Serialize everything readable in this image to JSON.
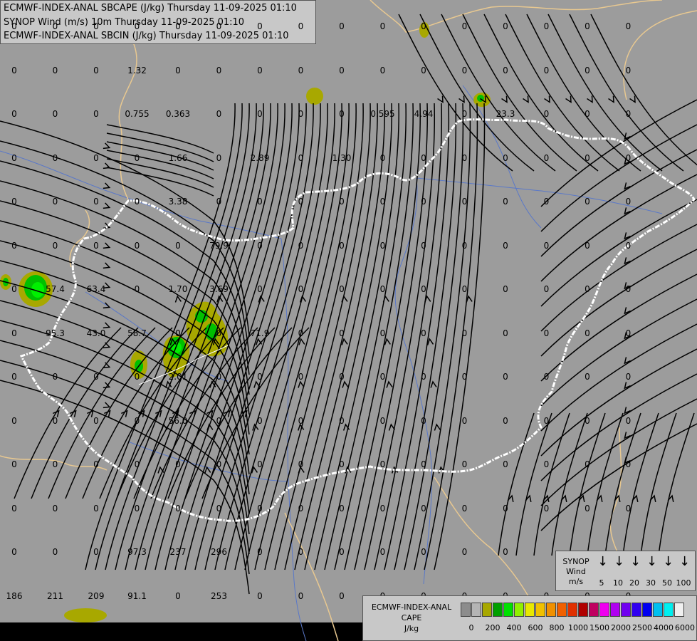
{
  "title": {
    "lines": [
      "ECMWF-INDEX-ANAL SBCAPE (J/kg) Thursday 11-09-2025 01:10",
      "SYNOP Wind (m/s) 10m Thursday 11-09-2025 01:10",
      "ECMWF-INDEX-ANAL SBCIN (J/kg) Thursday 11-09-2025 01:10"
    ]
  },
  "grid_values": [
    {
      "t": "0",
      "c": 0,
      "r": 0
    },
    {
      "t": "0",
      "c": 1,
      "r": 0
    },
    {
      "t": "0",
      "c": 2,
      "r": 0
    },
    {
      "t": "0",
      "c": 3,
      "r": 0
    },
    {
      "t": "0",
      "c": 4,
      "r": 0
    },
    {
      "t": "0",
      "c": 5,
      "r": 0
    },
    {
      "t": "0",
      "c": 6,
      "r": 0
    },
    {
      "t": "0",
      "c": 7,
      "r": 0
    },
    {
      "t": "0",
      "c": 8,
      "r": 0
    },
    {
      "t": "0",
      "c": 9,
      "r": 0
    },
    {
      "t": "0",
      "c": 10,
      "r": 0
    },
    {
      "t": "0",
      "c": 11,
      "r": 0
    },
    {
      "t": "0",
      "c": 12,
      "r": 0
    },
    {
      "t": "0",
      "c": 13,
      "r": 0
    },
    {
      "t": "0",
      "c": 14,
      "r": 0
    },
    {
      "t": "0",
      "c": 15,
      "r": 0
    },
    {
      "t": "0",
      "c": 0,
      "r": 1
    },
    {
      "t": "0",
      "c": 1,
      "r": 1
    },
    {
      "t": "0",
      "c": 2,
      "r": 1
    },
    {
      "t": "1.32",
      "c": 3,
      "r": 1
    },
    {
      "t": "0",
      "c": 4,
      "r": 1
    },
    {
      "t": "0",
      "c": 5,
      "r": 1
    },
    {
      "t": "0",
      "c": 6,
      "r": 1
    },
    {
      "t": "0",
      "c": 7,
      "r": 1
    },
    {
      "t": "0",
      "c": 8,
      "r": 1
    },
    {
      "t": "0",
      "c": 9,
      "r": 1
    },
    {
      "t": "0",
      "c": 10,
      "r": 1
    },
    {
      "t": "0",
      "c": 11,
      "r": 1
    },
    {
      "t": "0",
      "c": 12,
      "r": 1
    },
    {
      "t": "0",
      "c": 13,
      "r": 1
    },
    {
      "t": "0",
      "c": 14,
      "r": 1
    },
    {
      "t": "0",
      "c": 15,
      "r": 1
    },
    {
      "t": "0",
      "c": 0,
      "r": 2
    },
    {
      "t": "0",
      "c": 1,
      "r": 2
    },
    {
      "t": "0",
      "c": 2,
      "r": 2
    },
    {
      "t": "0.755",
      "c": 3,
      "r": 2
    },
    {
      "t": "0.363",
      "c": 4,
      "r": 2
    },
    {
      "t": "0",
      "c": 5,
      "r": 2
    },
    {
      "t": "0",
      "c": 6,
      "r": 2
    },
    {
      "t": "0",
      "c": 7,
      "r": 2
    },
    {
      "t": "0",
      "c": 8,
      "r": 2
    },
    {
      "t": "0.595",
      "c": 9,
      "r": 2
    },
    {
      "t": "4.94",
      "c": 10,
      "r": 2
    },
    {
      "t": "0",
      "c": 11,
      "r": 2
    },
    {
      "t": "23.3",
      "c": 12,
      "r": 2
    },
    {
      "t": "0",
      "c": 13,
      "r": 2
    },
    {
      "t": "0",
      "c": 14,
      "r": 2
    },
    {
      "t": "0",
      "c": 15,
      "r": 2
    },
    {
      "t": "0",
      "c": 0,
      "r": 3
    },
    {
      "t": "0",
      "c": 1,
      "r": 3
    },
    {
      "t": "0",
      "c": 2,
      "r": 3
    },
    {
      "t": "0",
      "c": 3,
      "r": 3
    },
    {
      "t": "1.66",
      "c": 4,
      "r": 3
    },
    {
      "t": "0",
      "c": 5,
      "r": 3
    },
    {
      "t": "2.89",
      "c": 6,
      "r": 3
    },
    {
      "t": "0",
      "c": 7,
      "r": 3
    },
    {
      "t": "1.30",
      "c": 8,
      "r": 3
    },
    {
      "t": "0",
      "c": 9,
      "r": 3
    },
    {
      "t": "0",
      "c": 10,
      "r": 3
    },
    {
      "t": "0",
      "c": 11,
      "r": 3
    },
    {
      "t": "0",
      "c": 12,
      "r": 3
    },
    {
      "t": "0",
      "c": 13,
      "r": 3
    },
    {
      "t": "0",
      "c": 14,
      "r": 3
    },
    {
      "t": "0",
      "c": 15,
      "r": 3
    },
    {
      "t": "0",
      "c": 0,
      "r": 4
    },
    {
      "t": "0",
      "c": 1,
      "r": 4
    },
    {
      "t": "0",
      "c": 2,
      "r": 4
    },
    {
      "t": "0",
      "c": 3,
      "r": 4
    },
    {
      "t": "3.38",
      "c": 4,
      "r": 4
    },
    {
      "t": "0",
      "c": 5,
      "r": 4
    },
    {
      "t": "0",
      "c": 6,
      "r": 4
    },
    {
      "t": "0",
      "c": 7,
      "r": 4
    },
    {
      "t": "0",
      "c": 8,
      "r": 4
    },
    {
      "t": "0",
      "c": 9,
      "r": 4
    },
    {
      "t": "0",
      "c": 10,
      "r": 4
    },
    {
      "t": "0",
      "c": 11,
      "r": 4
    },
    {
      "t": "0",
      "c": 12,
      "r": 4
    },
    {
      "t": "0",
      "c": 13,
      "r": 4
    },
    {
      "t": "0",
      "c": 14,
      "r": 4
    },
    {
      "t": "0",
      "c": 15,
      "r": 4
    },
    {
      "t": "0",
      "c": 0,
      "r": 5
    },
    {
      "t": "0",
      "c": 1,
      "r": 5
    },
    {
      "t": "0",
      "c": 2,
      "r": 5
    },
    {
      "t": "0",
      "c": 3,
      "r": 5
    },
    {
      "t": "0",
      "c": 4,
      "r": 5
    },
    {
      "t": "79.9",
      "c": 5,
      "r": 5
    },
    {
      "t": "0",
      "c": 6,
      "r": 5
    },
    {
      "t": "0",
      "c": 7,
      "r": 5
    },
    {
      "t": "0",
      "c": 8,
      "r": 5
    },
    {
      "t": "0",
      "c": 9,
      "r": 5
    },
    {
      "t": "0",
      "c": 10,
      "r": 5
    },
    {
      "t": "0",
      "c": 11,
      "r": 5
    },
    {
      "t": "0",
      "c": 12,
      "r": 5
    },
    {
      "t": "0",
      "c": 13,
      "r": 5
    },
    {
      "t": "0",
      "c": 14,
      "r": 5
    },
    {
      "t": "0",
      "c": 15,
      "r": 5
    },
    {
      "t": "0",
      "c": 0,
      "r": 6
    },
    {
      "t": "57.4",
      "c": 1,
      "r": 6
    },
    {
      "t": "63.4",
      "c": 2,
      "r": 6
    },
    {
      "t": "0",
      "c": 3,
      "r": 6
    },
    {
      "t": "1.70",
      "c": 4,
      "r": 6
    },
    {
      "t": "3.69",
      "c": 5,
      "r": 6
    },
    {
      "t": "0",
      "c": 6,
      "r": 6
    },
    {
      "t": "0",
      "c": 7,
      "r": 6
    },
    {
      "t": "0",
      "c": 8,
      "r": 6
    },
    {
      "t": "0",
      "c": 9,
      "r": 6
    },
    {
      "t": "0",
      "c": 10,
      "r": 6
    },
    {
      "t": "0",
      "c": 11,
      "r": 6
    },
    {
      "t": "0",
      "c": 12,
      "r": 6
    },
    {
      "t": "0",
      "c": 13,
      "r": 6
    },
    {
      "t": "0",
      "c": 14,
      "r": 6
    },
    {
      "t": "0",
      "c": 15,
      "r": 6
    },
    {
      "t": "0",
      "c": 0,
      "r": 7
    },
    {
      "t": "95.3",
      "c": 1,
      "r": 7
    },
    {
      "t": "43.0",
      "c": 2,
      "r": 7
    },
    {
      "t": "58.7",
      "c": 3,
      "r": 7
    },
    {
      "t": "0",
      "c": 4,
      "r": 7
    },
    {
      "t": "0",
      "c": 5,
      "r": 7
    },
    {
      "t": "71.9",
      "c": 6,
      "r": 7
    },
    {
      "t": "0",
      "c": 7,
      "r": 7
    },
    {
      "t": "0",
      "c": 8,
      "r": 7
    },
    {
      "t": "0",
      "c": 9,
      "r": 7
    },
    {
      "t": "0",
      "c": 10,
      "r": 7
    },
    {
      "t": "0",
      "c": 11,
      "r": 7
    },
    {
      "t": "0",
      "c": 12,
      "r": 7
    },
    {
      "t": "0",
      "c": 13,
      "r": 7
    },
    {
      "t": "0",
      "c": 14,
      "r": 7
    },
    {
      "t": "0",
      "c": 15,
      "r": 7
    },
    {
      "t": "0",
      "c": 0,
      "r": 8
    },
    {
      "t": "0",
      "c": 1,
      "r": 8
    },
    {
      "t": "0",
      "c": 2,
      "r": 8
    },
    {
      "t": "0",
      "c": 3,
      "r": 8
    },
    {
      "t": "2.01",
      "c": 4,
      "r": 8
    },
    {
      "t": "0",
      "c": 5,
      "r": 8
    },
    {
      "t": "0",
      "c": 6,
      "r": 8
    },
    {
      "t": "0",
      "c": 7,
      "r": 8
    },
    {
      "t": "0",
      "c": 8,
      "r": 8
    },
    {
      "t": "0",
      "c": 9,
      "r": 8
    },
    {
      "t": "0",
      "c": 10,
      "r": 8
    },
    {
      "t": "0",
      "c": 11,
      "r": 8
    },
    {
      "t": "0",
      "c": 12,
      "r": 8
    },
    {
      "t": "0",
      "c": 13,
      "r": 8
    },
    {
      "t": "0",
      "c": 14,
      "r": 8
    },
    {
      "t": "0",
      "c": 15,
      "r": 8
    },
    {
      "t": "0",
      "c": 0,
      "r": 9
    },
    {
      "t": "0",
      "c": 1,
      "r": 9
    },
    {
      "t": "0",
      "c": 2,
      "r": 9
    },
    {
      "t": "0",
      "c": 3,
      "r": 9
    },
    {
      "t": "56.0",
      "c": 4,
      "r": 9
    },
    {
      "t": "0",
      "c": 5,
      "r": 9
    },
    {
      "t": "0",
      "c": 6,
      "r": 9
    },
    {
      "t": "0",
      "c": 7,
      "r": 9
    },
    {
      "t": "0",
      "c": 8,
      "r": 9
    },
    {
      "t": "0",
      "c": 9,
      "r": 9
    },
    {
      "t": "0",
      "c": 10,
      "r": 9
    },
    {
      "t": "0",
      "c": 11,
      "r": 9
    },
    {
      "t": "0",
      "c": 12,
      "r": 9
    },
    {
      "t": "0",
      "c": 13,
      "r": 9
    },
    {
      "t": "0",
      "c": 14,
      "r": 9
    },
    {
      "t": "0",
      "c": 15,
      "r": 9
    },
    {
      "t": "0",
      "c": 0,
      "r": 10
    },
    {
      "t": "0",
      "c": 1,
      "r": 10
    },
    {
      "t": "0",
      "c": 2,
      "r": 10
    },
    {
      "t": "0",
      "c": 3,
      "r": 10
    },
    {
      "t": "0",
      "c": 4,
      "r": 10
    },
    {
      "t": "0",
      "c": 5,
      "r": 10
    },
    {
      "t": "0",
      "c": 6,
      "r": 10
    },
    {
      "t": "0",
      "c": 7,
      "r": 10
    },
    {
      "t": "0",
      "c": 8,
      "r": 10
    },
    {
      "t": "0",
      "c": 9,
      "r": 10
    },
    {
      "t": "0",
      "c": 10,
      "r": 10
    },
    {
      "t": "0",
      "c": 11,
      "r": 10
    },
    {
      "t": "0",
      "c": 12,
      "r": 10
    },
    {
      "t": "0",
      "c": 13,
      "r": 10
    },
    {
      "t": "0",
      "c": 14,
      "r": 10
    },
    {
      "t": "0",
      "c": 15,
      "r": 10
    },
    {
      "t": "0",
      "c": 0,
      "r": 11
    },
    {
      "t": "0",
      "c": 1,
      "r": 11
    },
    {
      "t": "0",
      "c": 2,
      "r": 11
    },
    {
      "t": "0",
      "c": 3,
      "r": 11
    },
    {
      "t": "0",
      "c": 4,
      "r": 11
    },
    {
      "t": "0",
      "c": 5,
      "r": 11
    },
    {
      "t": "0",
      "c": 6,
      "r": 11
    },
    {
      "t": "0",
      "c": 7,
      "r": 11
    },
    {
      "t": "0",
      "c": 8,
      "r": 11
    },
    {
      "t": "0",
      "c": 9,
      "r": 11
    },
    {
      "t": "0",
      "c": 10,
      "r": 11
    },
    {
      "t": "0",
      "c": 11,
      "r": 11
    },
    {
      "t": "0",
      "c": 12,
      "r": 11
    },
    {
      "t": "0",
      "c": 13,
      "r": 11
    },
    {
      "t": "0",
      "c": 14,
      "r": 11
    },
    {
      "t": "0",
      "c": 15,
      "r": 11
    },
    {
      "t": "0",
      "c": 0,
      "r": 12
    },
    {
      "t": "0",
      "c": 1,
      "r": 12
    },
    {
      "t": "0",
      "c": 2,
      "r": 12
    },
    {
      "t": "97.3",
      "c": 3,
      "r": 12
    },
    {
      "t": "237",
      "c": 4,
      "r": 12
    },
    {
      "t": "296",
      "c": 5,
      "r": 12
    },
    {
      "t": "0",
      "c": 6,
      "r": 12
    },
    {
      "t": "0",
      "c": 7,
      "r": 12
    },
    {
      "t": "0",
      "c": 8,
      "r": 12
    },
    {
      "t": "0",
      "c": 9,
      "r": 12
    },
    {
      "t": "0",
      "c": 10,
      "r": 12
    },
    {
      "t": "0",
      "c": 11,
      "r": 12
    },
    {
      "t": "0",
      "c": 12,
      "r": 12
    },
    {
      "t": "186",
      "c": 0,
      "r": 13
    },
    {
      "t": "211",
      "c": 1,
      "r": 13
    },
    {
      "t": "209",
      "c": 2,
      "r": 13
    },
    {
      "t": "91.1",
      "c": 3,
      "r": 13
    },
    {
      "t": "0",
      "c": 4,
      "r": 13
    },
    {
      "t": "253",
      "c": 5,
      "r": 13
    },
    {
      "t": "0",
      "c": 6,
      "r": 13
    },
    {
      "t": "0",
      "c": 7,
      "r": 13
    },
    {
      "t": "0",
      "c": 8,
      "r": 13
    },
    {
      "t": "0",
      "c": 9,
      "r": 13
    },
    {
      "t": "0",
      "c": 10,
      "r": 13
    },
    {
      "t": "0",
      "c": 11,
      "r": 13
    },
    {
      "t": "0",
      "c": 12,
      "r": 13
    },
    {
      "t": "0",
      "c": 13,
      "r": 13
    },
    {
      "t": "0",
      "c": 14,
      "r": 13
    },
    {
      "t": "0",
      "c": 15,
      "r": 13
    }
  ],
  "synop_legend": {
    "title_lines": [
      "SYNOP",
      "Wind",
      "m/s"
    ],
    "values": [
      "5",
      "10",
      "20",
      "30",
      "50",
      "100"
    ]
  },
  "cape_legend": {
    "title_lines": [
      "ECMWF-INDEX-ANAL",
      "CAPE",
      "J/kg"
    ],
    "colors": [
      "#8c8c8c",
      "#b4b4b4",
      "#a8a800",
      "#00a000",
      "#00e000",
      "#90f000",
      "#e8e800",
      "#f0c000",
      "#f09000",
      "#f06000",
      "#e03000",
      "#b00000",
      "#c00060",
      "#f000f0",
      "#b000f0",
      "#7000f0",
      "#3000f0",
      "#0000f0",
      "#00c0f0",
      "#00f0f0",
      "#f0f0f0"
    ],
    "ticks": [
      "0",
      "200",
      "400",
      "600",
      "800",
      "1000",
      "1500",
      "2000",
      "2500",
      "4000",
      "6000"
    ]
  },
  "map_colors": {
    "background": "#9c9c9c",
    "hungary_border": "#ffffff",
    "other_borders": "#e8c890",
    "rivers": "#5a78c8",
    "streamlines": "#000000",
    "cape_low": "#a8a800",
    "cape_mid": "#00c000",
    "cape_high": "#00f000"
  }
}
